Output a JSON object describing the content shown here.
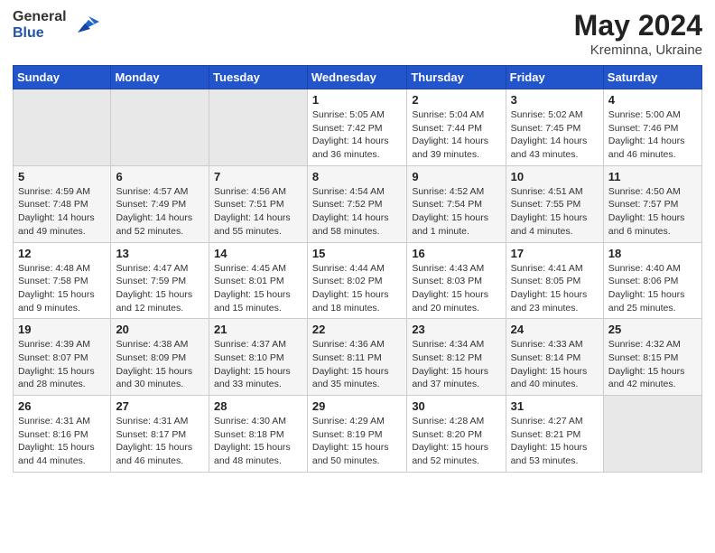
{
  "logo": {
    "general": "General",
    "blue": "Blue"
  },
  "title": {
    "month_year": "May 2024",
    "location": "Kreminna, Ukraine"
  },
  "weekdays": [
    "Sunday",
    "Monday",
    "Tuesday",
    "Wednesday",
    "Thursday",
    "Friday",
    "Saturday"
  ],
  "weeks": [
    [
      {
        "day": "",
        "info": ""
      },
      {
        "day": "",
        "info": ""
      },
      {
        "day": "",
        "info": ""
      },
      {
        "day": "1",
        "info": "Sunrise: 5:05 AM\nSunset: 7:42 PM\nDaylight: 14 hours and 36 minutes."
      },
      {
        "day": "2",
        "info": "Sunrise: 5:04 AM\nSunset: 7:44 PM\nDaylight: 14 hours and 39 minutes."
      },
      {
        "day": "3",
        "info": "Sunrise: 5:02 AM\nSunset: 7:45 PM\nDaylight: 14 hours and 43 minutes."
      },
      {
        "day": "4",
        "info": "Sunrise: 5:00 AM\nSunset: 7:46 PM\nDaylight: 14 hours and 46 minutes."
      }
    ],
    [
      {
        "day": "5",
        "info": "Sunrise: 4:59 AM\nSunset: 7:48 PM\nDaylight: 14 hours and 49 minutes."
      },
      {
        "day": "6",
        "info": "Sunrise: 4:57 AM\nSunset: 7:49 PM\nDaylight: 14 hours and 52 minutes."
      },
      {
        "day": "7",
        "info": "Sunrise: 4:56 AM\nSunset: 7:51 PM\nDaylight: 14 hours and 55 minutes."
      },
      {
        "day": "8",
        "info": "Sunrise: 4:54 AM\nSunset: 7:52 PM\nDaylight: 14 hours and 58 minutes."
      },
      {
        "day": "9",
        "info": "Sunrise: 4:52 AM\nSunset: 7:54 PM\nDaylight: 15 hours and 1 minute."
      },
      {
        "day": "10",
        "info": "Sunrise: 4:51 AM\nSunset: 7:55 PM\nDaylight: 15 hours and 4 minutes."
      },
      {
        "day": "11",
        "info": "Sunrise: 4:50 AM\nSunset: 7:57 PM\nDaylight: 15 hours and 6 minutes."
      }
    ],
    [
      {
        "day": "12",
        "info": "Sunrise: 4:48 AM\nSunset: 7:58 PM\nDaylight: 15 hours and 9 minutes."
      },
      {
        "day": "13",
        "info": "Sunrise: 4:47 AM\nSunset: 7:59 PM\nDaylight: 15 hours and 12 minutes."
      },
      {
        "day": "14",
        "info": "Sunrise: 4:45 AM\nSunset: 8:01 PM\nDaylight: 15 hours and 15 minutes."
      },
      {
        "day": "15",
        "info": "Sunrise: 4:44 AM\nSunset: 8:02 PM\nDaylight: 15 hours and 18 minutes."
      },
      {
        "day": "16",
        "info": "Sunrise: 4:43 AM\nSunset: 8:03 PM\nDaylight: 15 hours and 20 minutes."
      },
      {
        "day": "17",
        "info": "Sunrise: 4:41 AM\nSunset: 8:05 PM\nDaylight: 15 hours and 23 minutes."
      },
      {
        "day": "18",
        "info": "Sunrise: 4:40 AM\nSunset: 8:06 PM\nDaylight: 15 hours and 25 minutes."
      }
    ],
    [
      {
        "day": "19",
        "info": "Sunrise: 4:39 AM\nSunset: 8:07 PM\nDaylight: 15 hours and 28 minutes."
      },
      {
        "day": "20",
        "info": "Sunrise: 4:38 AM\nSunset: 8:09 PM\nDaylight: 15 hours and 30 minutes."
      },
      {
        "day": "21",
        "info": "Sunrise: 4:37 AM\nSunset: 8:10 PM\nDaylight: 15 hours and 33 minutes."
      },
      {
        "day": "22",
        "info": "Sunrise: 4:36 AM\nSunset: 8:11 PM\nDaylight: 15 hours and 35 minutes."
      },
      {
        "day": "23",
        "info": "Sunrise: 4:34 AM\nSunset: 8:12 PM\nDaylight: 15 hours and 37 minutes."
      },
      {
        "day": "24",
        "info": "Sunrise: 4:33 AM\nSunset: 8:14 PM\nDaylight: 15 hours and 40 minutes."
      },
      {
        "day": "25",
        "info": "Sunrise: 4:32 AM\nSunset: 8:15 PM\nDaylight: 15 hours and 42 minutes."
      }
    ],
    [
      {
        "day": "26",
        "info": "Sunrise: 4:31 AM\nSunset: 8:16 PM\nDaylight: 15 hours and 44 minutes."
      },
      {
        "day": "27",
        "info": "Sunrise: 4:31 AM\nSunset: 8:17 PM\nDaylight: 15 hours and 46 minutes."
      },
      {
        "day": "28",
        "info": "Sunrise: 4:30 AM\nSunset: 8:18 PM\nDaylight: 15 hours and 48 minutes."
      },
      {
        "day": "29",
        "info": "Sunrise: 4:29 AM\nSunset: 8:19 PM\nDaylight: 15 hours and 50 minutes."
      },
      {
        "day": "30",
        "info": "Sunrise: 4:28 AM\nSunset: 8:20 PM\nDaylight: 15 hours and 52 minutes."
      },
      {
        "day": "31",
        "info": "Sunrise: 4:27 AM\nSunset: 8:21 PM\nDaylight: 15 hours and 53 minutes."
      },
      {
        "day": "",
        "info": ""
      }
    ]
  ]
}
